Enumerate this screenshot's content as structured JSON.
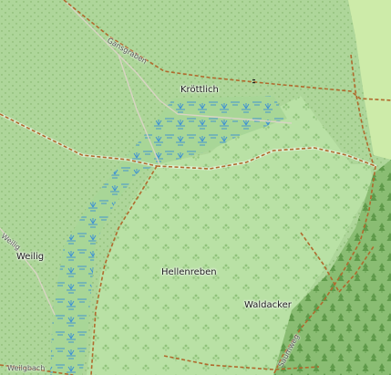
{
  "map": {
    "labels": {
      "krottlich": "Kröttlich",
      "weilig": "Weilig",
      "hellenreben": "Hellenreben",
      "waldacker": "Waldacker"
    },
    "roads": {
      "gansgraben": "Gansgraben",
      "saumweg": "Saumweg",
      "weilig_road": "Weilig",
      "weilgbach": "Weilgbach"
    },
    "colors": {
      "meadow": "#aed69a",
      "orchard": "#b9e1a5",
      "forest": "#9ccc85",
      "dark_forest": "#8abd73",
      "farmland": "#cdeba9",
      "wetland_symbol": "#3a8fd6",
      "track": "#b06a2d",
      "footpath": "#d9c9a6"
    },
    "icons": [
      "wetland-icon",
      "tree-icon",
      "orchard-icon",
      "peak-icon"
    ]
  }
}
